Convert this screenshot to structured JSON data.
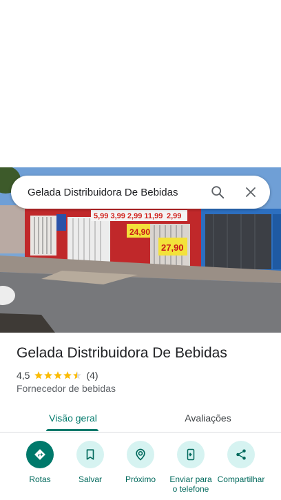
{
  "search": {
    "query": "Gelada Distribuidora De Bebidas",
    "search_icon": "search-icon",
    "close_icon": "close-icon"
  },
  "photo": {
    "description_icon": "storefront-photo",
    "signs": [
      "5,99",
      "3,99",
      "2,99",
      "11,99",
      "2,99",
      "24,90",
      "27,90"
    ]
  },
  "place": {
    "title": "Gelada Distribuidora De Bebidas",
    "rating": "4,5",
    "rating_value": 4.5,
    "review_count": "(4)",
    "category": "Fornecedor de bebidas"
  },
  "tabs": [
    {
      "label": "Visão geral",
      "selected": true
    },
    {
      "label": "Avaliações",
      "selected": false
    }
  ],
  "actions": [
    {
      "label": "Rotas",
      "icon": "directions-icon",
      "primary": true
    },
    {
      "label": "Salvar",
      "icon": "bookmark-icon",
      "primary": false
    },
    {
      "label": "Próximo",
      "icon": "nearby-icon",
      "primary": false
    },
    {
      "label": "Enviar para o telefone",
      "icon": "send-to-phone-icon",
      "primary": false
    },
    {
      "label": "Compartilhar",
      "icon": "share-icon",
      "primary": false
    }
  ],
  "colors": {
    "accent": "#00796b",
    "action_bg": "#d6f3f1",
    "star": "#fbbc04",
    "text": "#202124"
  }
}
